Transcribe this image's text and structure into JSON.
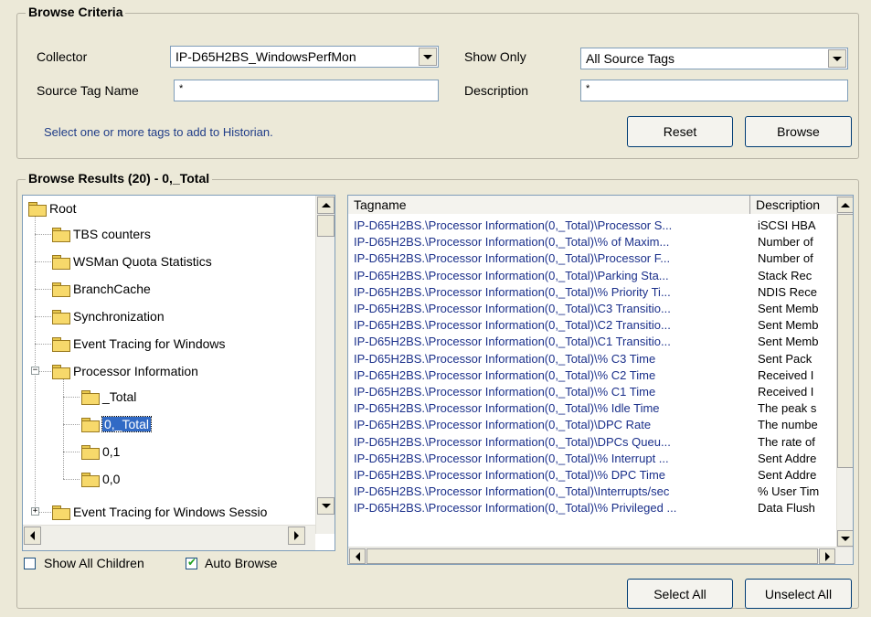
{
  "criteria": {
    "title": "Browse Criteria",
    "collector_label": "Collector",
    "collector_value": "IP-D65H2BS_WindowsPerfMon",
    "show_only_label": "Show Only",
    "show_only_value": "All Source Tags",
    "source_tag_label": "Source Tag Name",
    "source_tag_value": "*",
    "description_label": "Description",
    "description_value": "*",
    "hint": "Select one or more tags to add to Historian.",
    "reset_label": "Reset",
    "browse_label": "Browse"
  },
  "results": {
    "title": "Browse Results (20) - 0,_Total",
    "tree": [
      {
        "label": "Root"
      },
      {
        "label": "TBS counters"
      },
      {
        "label": "WSMan Quota Statistics"
      },
      {
        "label": "BranchCache"
      },
      {
        "label": "Synchronization"
      },
      {
        "label": "Event Tracing for Windows"
      },
      {
        "label": "Processor Information"
      },
      {
        "label": "_Total"
      },
      {
        "label": "0,_Total"
      },
      {
        "label": "0,1"
      },
      {
        "label": "0,0"
      },
      {
        "label": "Event Tracing for Windows Sessio"
      }
    ],
    "columns": [
      "Tagname",
      "Description"
    ],
    "rows": [
      {
        "tag": "IP-D65H2BS.\\Processor Information(0,_Total)\\Processor S...",
        "desc": "iSCSI HBA"
      },
      {
        "tag": "IP-D65H2BS.\\Processor Information(0,_Total)\\% of Maxim...",
        "desc": "Number of"
      },
      {
        "tag": "IP-D65H2BS.\\Processor Information(0,_Total)\\Processor F...",
        "desc": "Number of"
      },
      {
        "tag": "IP-D65H2BS.\\Processor Information(0,_Total)\\Parking Sta...",
        "desc": "Stack Rec"
      },
      {
        "tag": "IP-D65H2BS.\\Processor Information(0,_Total)\\% Priority Ti...",
        "desc": "NDIS Rece"
      },
      {
        "tag": "IP-D65H2BS.\\Processor Information(0,_Total)\\C3 Transitio...",
        "desc": "Sent Memb"
      },
      {
        "tag": "IP-D65H2BS.\\Processor Information(0,_Total)\\C2 Transitio...",
        "desc": "Sent Memb"
      },
      {
        "tag": "IP-D65H2BS.\\Processor Information(0,_Total)\\C1 Transitio...",
        "desc": "Sent Memb"
      },
      {
        "tag": "IP-D65H2BS.\\Processor Information(0,_Total)\\% C3 Time",
        "desc": "Sent Pack"
      },
      {
        "tag": "IP-D65H2BS.\\Processor Information(0,_Total)\\% C2 Time",
        "desc": "Received I"
      },
      {
        "tag": "IP-D65H2BS.\\Processor Information(0,_Total)\\% C1 Time",
        "desc": "Received I"
      },
      {
        "tag": "IP-D65H2BS.\\Processor Information(0,_Total)\\% Idle Time",
        "desc": "The peak s"
      },
      {
        "tag": "IP-D65H2BS.\\Processor Information(0,_Total)\\DPC Rate",
        "desc": "The numbe"
      },
      {
        "tag": "IP-D65H2BS.\\Processor Information(0,_Total)\\DPCs Queu...",
        "desc": "The rate of"
      },
      {
        "tag": "IP-D65H2BS.\\Processor Information(0,_Total)\\% Interrupt ...",
        "desc": "Sent Addre"
      },
      {
        "tag": "IP-D65H2BS.\\Processor Information(0,_Total)\\% DPC Time",
        "desc": "Sent Addre"
      },
      {
        "tag": "IP-D65H2BS.\\Processor Information(0,_Total)\\Interrupts/sec",
        "desc": "% User Tim"
      },
      {
        "tag": "IP-D65H2BS.\\Processor Information(0,_Total)\\% Privileged ...",
        "desc": "Data Flush"
      }
    ],
    "show_all_children_label": "Show All Children",
    "show_all_children_checked": false,
    "auto_browse_label": "Auto Browse",
    "auto_browse_checked": true,
    "select_all_label": "Select All",
    "unselect_all_label": "Unselect All"
  }
}
